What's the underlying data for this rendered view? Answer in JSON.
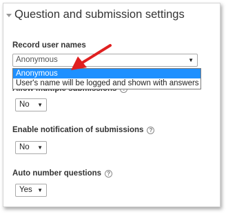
{
  "section": {
    "title": "Question and submission settings"
  },
  "record_user_names": {
    "label": "Record user names",
    "current_value": "Anonymous",
    "options": [
      "Anonymous",
      "User's name will be logged and shown with answers"
    ]
  },
  "allow_multiple": {
    "label": "Allow multiple submissions",
    "value": "No"
  },
  "notification": {
    "label": "Enable notification of submissions",
    "value": "No"
  },
  "auto_number": {
    "label": "Auto number questions",
    "value": "Yes"
  },
  "icons": {
    "collapse": "caret-down-icon",
    "help": "help-icon",
    "dropdown": "dropdown-arrow-icon"
  },
  "colors": {
    "selected_option": "#1e90ff",
    "annotation_arrow": "#e02020"
  }
}
